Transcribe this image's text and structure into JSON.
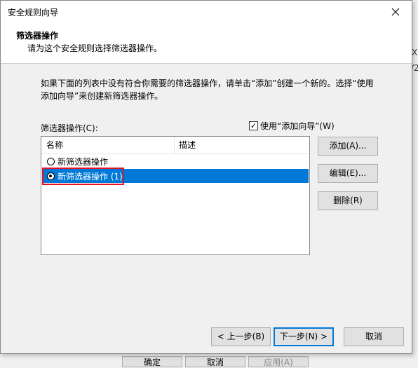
{
  "background": {
    "right_glyph_1": "X",
    "right_glyph_2": "/2",
    "bottom_buttons": [
      "确定",
      "取消",
      "应用(A)"
    ]
  },
  "dialog": {
    "title": "安全规则向导",
    "header": {
      "title": "筛选器操作",
      "subtitle": "请为这个安全规则选择筛选器操作。"
    },
    "description": "如果下面的列表中没有符合你需要的筛选器操作，请单击“添加”创建一个新的。选择“使用添加向导”来创建新筛选器操作。",
    "list_label": "筛选器操作(C):",
    "use_wizard": {
      "label": "使用“添加向导”(W)",
      "checked": true,
      "check_glyph": "✓"
    },
    "columns": [
      "名称",
      "描述"
    ],
    "rows": [
      {
        "name": "新筛选器操作",
        "description": "",
        "selected": false
      },
      {
        "name": "新筛选器操作 (1)",
        "description": "",
        "selected": true
      }
    ],
    "side_buttons": {
      "add": "添加(A)...",
      "edit": "编辑(E)...",
      "delete": "删除(R)"
    },
    "footer": {
      "back": "< 上一步(B)",
      "next": "下一步(N) >",
      "cancel": "取消"
    },
    "colors": {
      "selection": "#0078d7",
      "highlight_box": "#e81123"
    }
  }
}
